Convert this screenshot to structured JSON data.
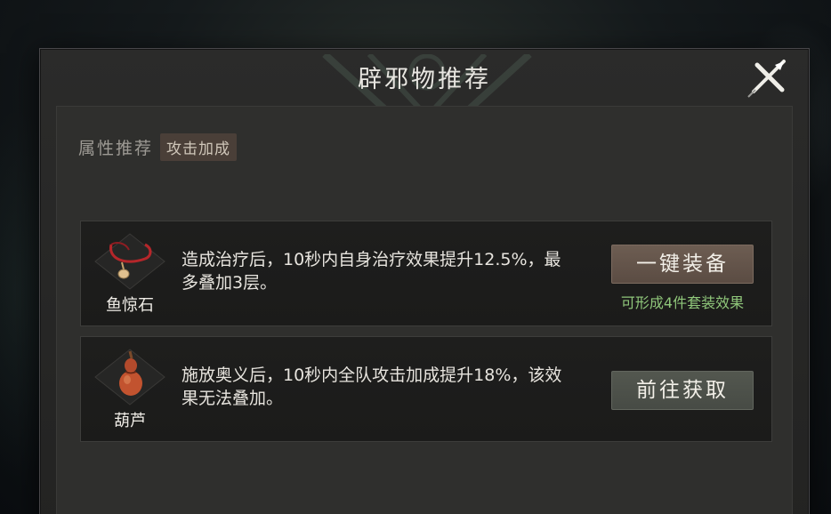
{
  "dialog": {
    "title": "辟邪物推荐"
  },
  "attribute": {
    "label": "属性推荐",
    "tag": "攻击加成"
  },
  "items": [
    {
      "name": "鱼惊石",
      "icon": "pendant-necklace-icon",
      "description": "造成治疗后，10秒内自身治疗效果提升12.5%，最多叠加3层。",
      "action_label": "一键装备",
      "note": "可形成4件套装效果"
    },
    {
      "name": "葫芦",
      "icon": "gourd-icon",
      "description": "施放奥义后，10秒内全队攻击加成提升18%，该效果无法叠加。",
      "action_label": "前往获取"
    }
  ],
  "colors": {
    "set_note": "#8fc67a",
    "equip_button": "#5b4c43",
    "obtain_button": "#474b45"
  }
}
